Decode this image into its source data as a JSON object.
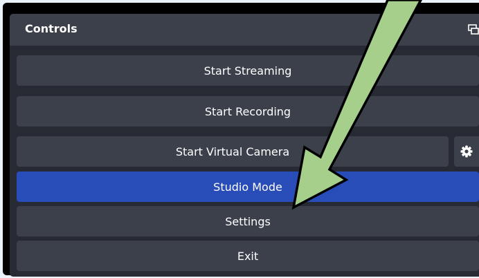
{
  "dock": {
    "title": "Controls",
    "undock_icon": "undock-icon"
  },
  "buttons": {
    "start_streaming": "Start Streaming",
    "start_recording": "Start Recording",
    "start_virtual_camera": "Start Virtual Camera",
    "virtual_camera_settings_icon": "gear-icon",
    "studio_mode": "Studio Mode",
    "settings": "Settings",
    "exit": "Exit"
  },
  "state": {
    "studio_mode_active": true
  },
  "colors": {
    "panel_background": "#272a33",
    "button_background": "#3c404b",
    "active_button": "#284cb8",
    "annotation_arrow_fill": "#a6cf8c",
    "annotation_arrow_stroke": "#000000"
  }
}
